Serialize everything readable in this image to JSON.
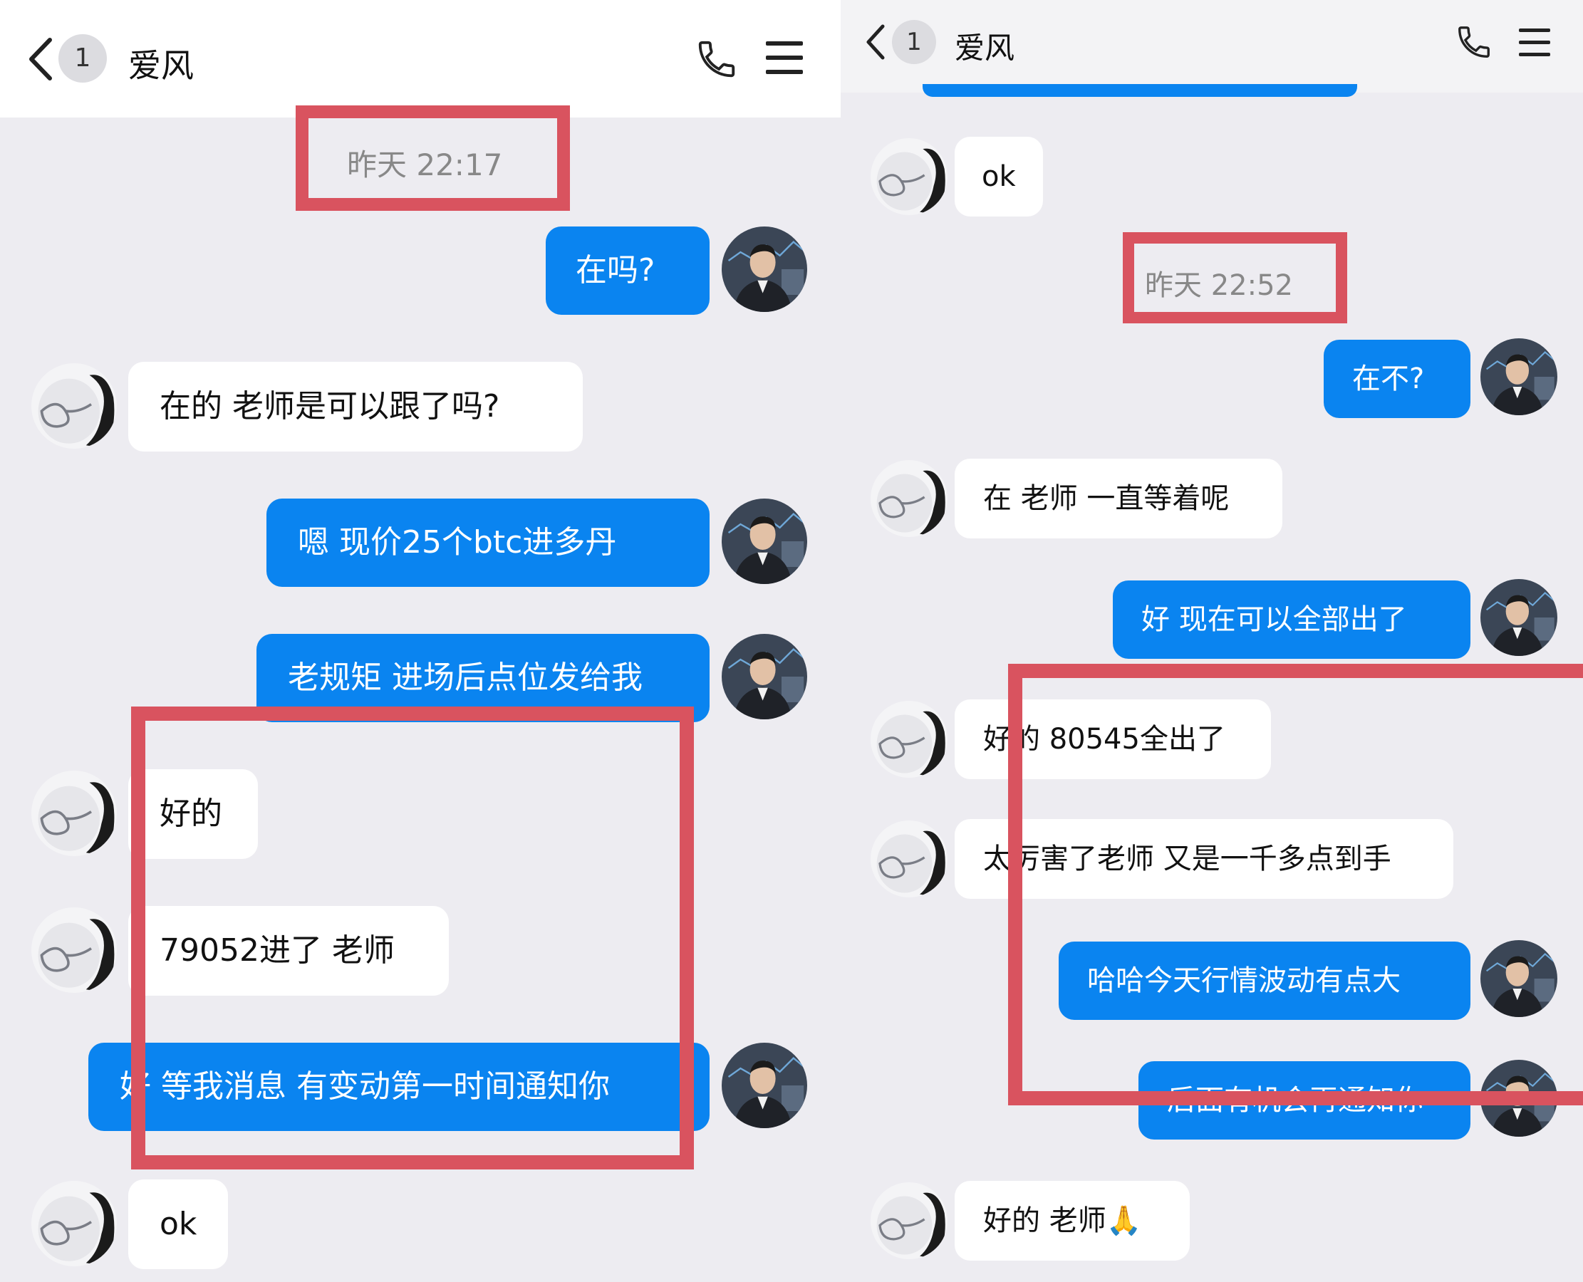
{
  "left_screen": {
    "header": {
      "unread_count": "1",
      "contact_name": "爱风"
    },
    "timestamp": "昨天 22:17",
    "messages": [
      {
        "from": "me",
        "text": "在吗?"
      },
      {
        "from": "them",
        "text": "在的 老师是可以跟了吗?"
      },
      {
        "from": "me",
        "text": "嗯   现价25个btc进多丹"
      },
      {
        "from": "me",
        "text": "老规矩 进场后点位发给我"
      },
      {
        "from": "them",
        "text": "好的"
      },
      {
        "from": "them",
        "text": "79052进了  老师"
      },
      {
        "from": "me",
        "text": "好   等我消息  有变动第一时间通知你"
      },
      {
        "from": "them",
        "text": "ok"
      }
    ]
  },
  "right_screen": {
    "header": {
      "unread_count": "1",
      "contact_name": "爱风"
    },
    "timestamp": "昨天 22:52",
    "messages": [
      {
        "from": "them",
        "text": "ok"
      },
      {
        "from": "me",
        "text": "在不?"
      },
      {
        "from": "them",
        "text": "在 老师  一直等着呢"
      },
      {
        "from": "me",
        "text": "好   现在可以全部出了"
      },
      {
        "from": "them",
        "text": "好的  80545全出了"
      },
      {
        "from": "them",
        "text": "太厉害了老师  又是一千多点到手"
      },
      {
        "from": "me",
        "text": "哈哈今天行情波动有点大"
      },
      {
        "from": "me",
        "text": "后面有机会再通知你"
      },
      {
        "from": "them",
        "text": "好的  老师🙏"
      }
    ]
  },
  "colors": {
    "sent_bubble": "#0a84f0",
    "received_bubble": "#ffffff",
    "background": "#edecf1",
    "highlight_box": "#d9535f"
  },
  "icons": [
    "back-chevron-icon",
    "phone-icon",
    "menu-icon",
    "avatar-user-icon",
    "avatar-contact-icon"
  ]
}
